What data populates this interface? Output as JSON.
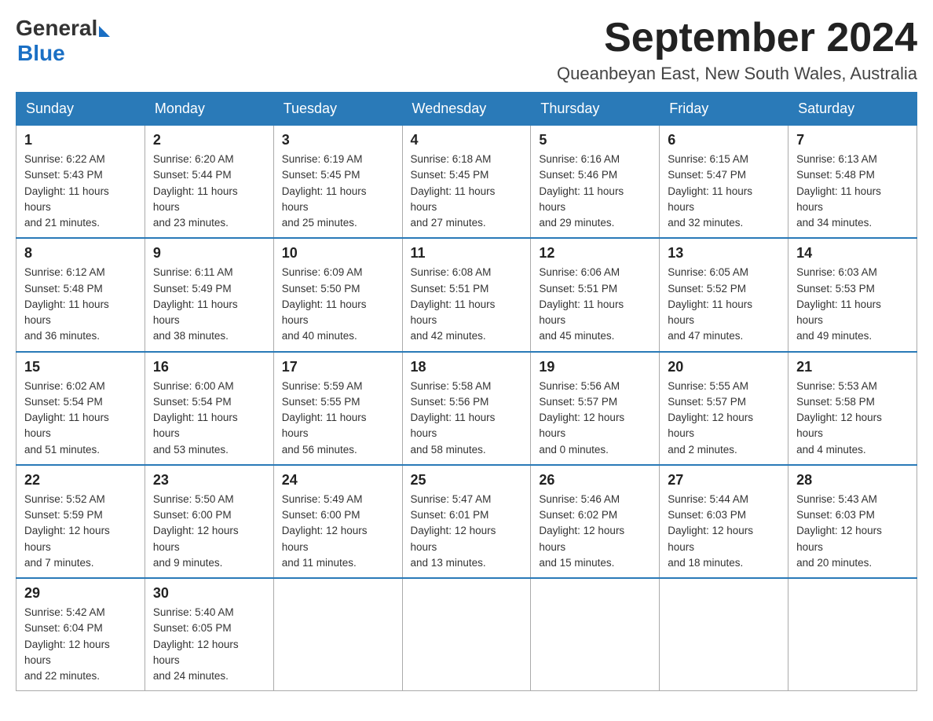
{
  "logo": {
    "general": "General",
    "blue": "Blue"
  },
  "title": {
    "month": "September 2024",
    "location": "Queanbeyan East, New South Wales, Australia"
  },
  "headers": [
    "Sunday",
    "Monday",
    "Tuesday",
    "Wednesday",
    "Thursday",
    "Friday",
    "Saturday"
  ],
  "weeks": [
    [
      {
        "day": "1",
        "sunrise": "6:22 AM",
        "sunset": "5:43 PM",
        "daylight": "11 hours and 21 minutes."
      },
      {
        "day": "2",
        "sunrise": "6:20 AM",
        "sunset": "5:44 PM",
        "daylight": "11 hours and 23 minutes."
      },
      {
        "day": "3",
        "sunrise": "6:19 AM",
        "sunset": "5:45 PM",
        "daylight": "11 hours and 25 minutes."
      },
      {
        "day": "4",
        "sunrise": "6:18 AM",
        "sunset": "5:45 PM",
        "daylight": "11 hours and 27 minutes."
      },
      {
        "day": "5",
        "sunrise": "6:16 AM",
        "sunset": "5:46 PM",
        "daylight": "11 hours and 29 minutes."
      },
      {
        "day": "6",
        "sunrise": "6:15 AM",
        "sunset": "5:47 PM",
        "daylight": "11 hours and 32 minutes."
      },
      {
        "day": "7",
        "sunrise": "6:13 AM",
        "sunset": "5:48 PM",
        "daylight": "11 hours and 34 minutes."
      }
    ],
    [
      {
        "day": "8",
        "sunrise": "6:12 AM",
        "sunset": "5:48 PM",
        "daylight": "11 hours and 36 minutes."
      },
      {
        "day": "9",
        "sunrise": "6:11 AM",
        "sunset": "5:49 PM",
        "daylight": "11 hours and 38 minutes."
      },
      {
        "day": "10",
        "sunrise": "6:09 AM",
        "sunset": "5:50 PM",
        "daylight": "11 hours and 40 minutes."
      },
      {
        "day": "11",
        "sunrise": "6:08 AM",
        "sunset": "5:51 PM",
        "daylight": "11 hours and 42 minutes."
      },
      {
        "day": "12",
        "sunrise": "6:06 AM",
        "sunset": "5:51 PM",
        "daylight": "11 hours and 45 minutes."
      },
      {
        "day": "13",
        "sunrise": "6:05 AM",
        "sunset": "5:52 PM",
        "daylight": "11 hours and 47 minutes."
      },
      {
        "day": "14",
        "sunrise": "6:03 AM",
        "sunset": "5:53 PM",
        "daylight": "11 hours and 49 minutes."
      }
    ],
    [
      {
        "day": "15",
        "sunrise": "6:02 AM",
        "sunset": "5:54 PM",
        "daylight": "11 hours and 51 minutes."
      },
      {
        "day": "16",
        "sunrise": "6:00 AM",
        "sunset": "5:54 PM",
        "daylight": "11 hours and 53 minutes."
      },
      {
        "day": "17",
        "sunrise": "5:59 AM",
        "sunset": "5:55 PM",
        "daylight": "11 hours and 56 minutes."
      },
      {
        "day": "18",
        "sunrise": "5:58 AM",
        "sunset": "5:56 PM",
        "daylight": "11 hours and 58 minutes."
      },
      {
        "day": "19",
        "sunrise": "5:56 AM",
        "sunset": "5:57 PM",
        "daylight": "12 hours and 0 minutes."
      },
      {
        "day": "20",
        "sunrise": "5:55 AM",
        "sunset": "5:57 PM",
        "daylight": "12 hours and 2 minutes."
      },
      {
        "day": "21",
        "sunrise": "5:53 AM",
        "sunset": "5:58 PM",
        "daylight": "12 hours and 4 minutes."
      }
    ],
    [
      {
        "day": "22",
        "sunrise": "5:52 AM",
        "sunset": "5:59 PM",
        "daylight": "12 hours and 7 minutes."
      },
      {
        "day": "23",
        "sunrise": "5:50 AM",
        "sunset": "6:00 PM",
        "daylight": "12 hours and 9 minutes."
      },
      {
        "day": "24",
        "sunrise": "5:49 AM",
        "sunset": "6:00 PM",
        "daylight": "12 hours and 11 minutes."
      },
      {
        "day": "25",
        "sunrise": "5:47 AM",
        "sunset": "6:01 PM",
        "daylight": "12 hours and 13 minutes."
      },
      {
        "day": "26",
        "sunrise": "5:46 AM",
        "sunset": "6:02 PM",
        "daylight": "12 hours and 15 minutes."
      },
      {
        "day": "27",
        "sunrise": "5:44 AM",
        "sunset": "6:03 PM",
        "daylight": "12 hours and 18 minutes."
      },
      {
        "day": "28",
        "sunrise": "5:43 AM",
        "sunset": "6:03 PM",
        "daylight": "12 hours and 20 minutes."
      }
    ],
    [
      {
        "day": "29",
        "sunrise": "5:42 AM",
        "sunset": "6:04 PM",
        "daylight": "12 hours and 22 minutes."
      },
      {
        "day": "30",
        "sunrise": "5:40 AM",
        "sunset": "6:05 PM",
        "daylight": "12 hours and 24 minutes."
      },
      null,
      null,
      null,
      null,
      null
    ]
  ],
  "labels": {
    "sunrise": "Sunrise:",
    "sunset": "Sunset:",
    "daylight": "Daylight:"
  }
}
